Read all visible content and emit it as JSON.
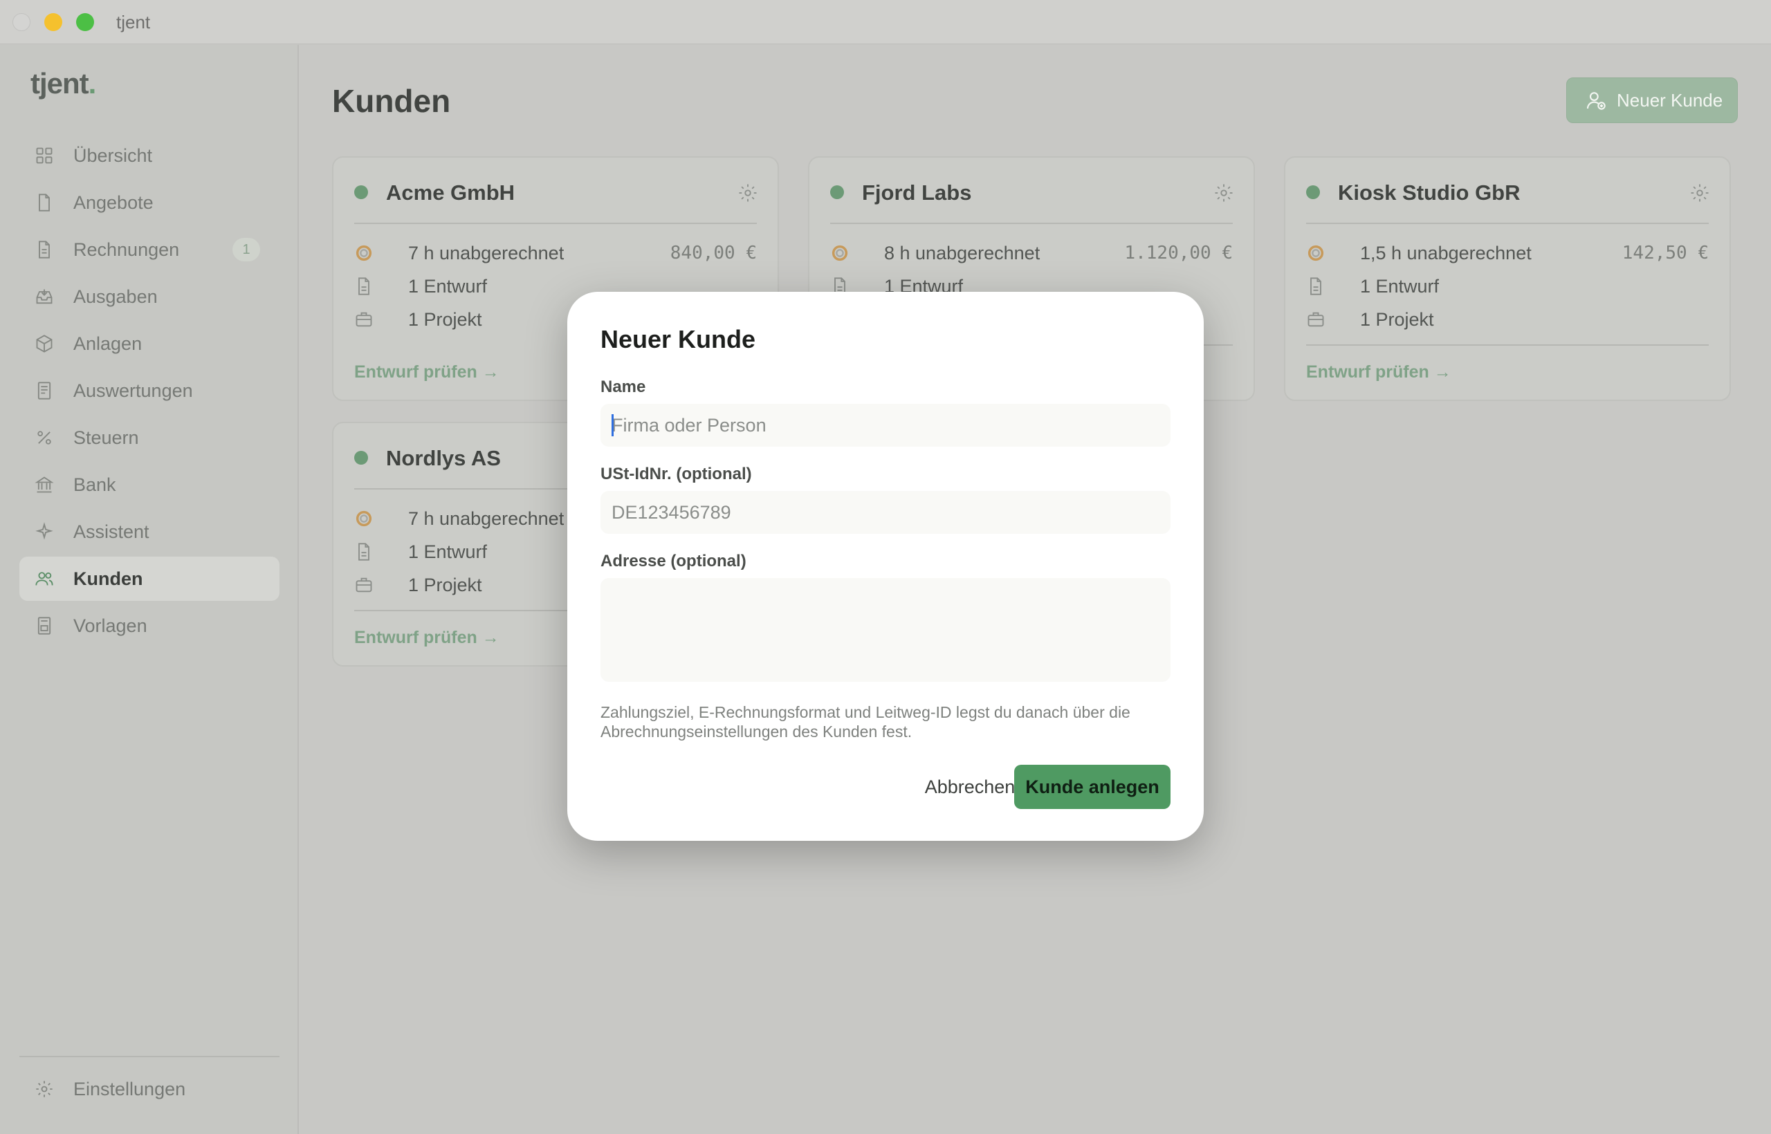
{
  "window": {
    "title": "tjent"
  },
  "sidebar": {
    "logo": "tjent",
    "logo_dot": ".",
    "items": [
      {
        "label": "Übersicht",
        "icon": "grid-icon"
      },
      {
        "label": "Angebote",
        "icon": "document-icon"
      },
      {
        "label": "Rechnungen",
        "icon": "document-icon",
        "badge": "1"
      },
      {
        "label": "Ausgaben",
        "icon": "inbox-icon"
      },
      {
        "label": "Anlagen",
        "icon": "box-icon"
      },
      {
        "label": "Auswertungen",
        "icon": "report-icon"
      },
      {
        "label": "Steuern",
        "icon": "percent-icon"
      },
      {
        "label": "Bank",
        "icon": "bank-icon"
      },
      {
        "label": "Assistent",
        "icon": "sparkle-icon"
      },
      {
        "label": "Kunden",
        "icon": "users-icon",
        "active": true
      },
      {
        "label": "Vorlagen",
        "icon": "template-icon"
      }
    ],
    "settings_label": "Einstellungen"
  },
  "main": {
    "title": "Kunden",
    "new_button_label": "Neuer Kunde",
    "cards": [
      {
        "name": "Acme GmbH",
        "hours": "7 h unabgerechnet",
        "amount": "840,00 €",
        "drafts": "1 Entwurf",
        "projects": "1 Projekt",
        "link": "Entwurf prüfen →"
      },
      {
        "name": "Fjord Labs",
        "hours": "8 h unabgerechnet",
        "amount": "1.120,00 €",
        "drafts": "1 Entwurf"
      },
      {
        "name": "Kiosk Studio GbR",
        "hours": "1,5 h unabgerechnet",
        "amount": "142,50 €",
        "drafts": "1 Entwurf",
        "projects": "1 Projekt",
        "link": "Entwurf prüfen →"
      },
      {
        "name": "Nordlys AS",
        "hours": "7 h unabgerechnet",
        "drafts": "1 Entwurf",
        "projects": "1 Projekt",
        "link": "Entwurf prüfen →"
      }
    ]
  },
  "modal": {
    "title": "Neuer Kunde",
    "name_label": "Name",
    "name_placeholder": "Firma oder Person",
    "vat_label": "USt-IdNr. (optional)",
    "vat_placeholder": "DE123456789",
    "address_label": "Adresse (optional)",
    "hint": "Zahlungsziel, E-Rechnungsformat und Leitweg-ID legst du danach über die Abrechnungseinstellungen des Kunden fest.",
    "cancel_label": "Abbrechen",
    "submit_label": "Kunde anlegen"
  },
  "colors": {
    "accent": "#4f9a62",
    "status_active": "#6c9a76"
  }
}
